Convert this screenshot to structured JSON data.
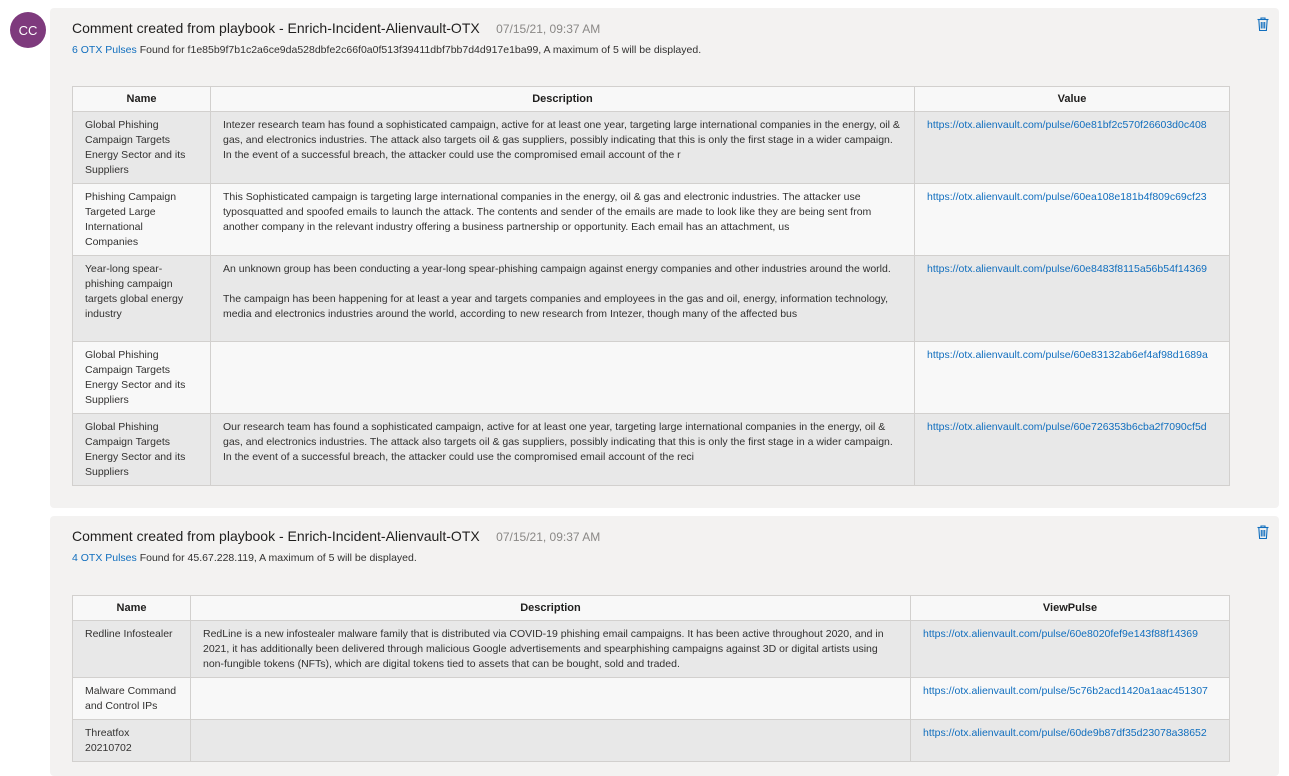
{
  "avatar": {
    "initials": "CC"
  },
  "comments": [
    {
      "title": "Comment created from playbook - Enrich-Incident-Alienvault-OTX",
      "time": "07/15/21, 09:37 AM",
      "link_text": "6 OTX Pulses",
      "summary": " Found for f1e85b9f7b1c2a6ce9da528dbfe2c66f0a0f513f39411dbf7bb7d4d917e1ba99, A maximum of 5 will be displayed.",
      "columns": [
        "Name",
        "Description",
        "Value"
      ],
      "rows": [
        {
          "name": "Global Phishing Campaign Targets Energy Sector and its Suppliers",
          "description": [
            "Intezer research team has found a sophisticated campaign, active for at least one year, targeting large international companies in the energy, oil & gas, and electronics industries. The attack also targets oil & gas suppliers, possibly indicating that this is only the first stage in a wider campaign. In the event of a successful breach, the attacker could use the compromised email account of the r"
          ],
          "value": "https://otx.alienvault.com/pulse/60e81bf2c570f26603d0c408"
        },
        {
          "name": "Phishing Campaign Targeted Large International Companies",
          "description": [
            "This Sophisticated campaign is targeting large international companies in the energy, oil & gas and electronic industries. The attacker use typosquatted and spoofed emails to launch the attack. The contents and sender of the emails are made to look like they are being sent from another company in the relevant industry offering a business partnership or opportunity. Each email has an attachment, us"
          ],
          "value": "https://otx.alienvault.com/pulse/60ea108e181b4f809c69cf23"
        },
        {
          "name": "Year-long spear-phishing campaign targets global energy industry",
          "description": [
            "An unknown group has been conducting a year-long spear-phishing campaign against energy companies and other industries around the world.",
            "The campaign has been happening for at least a year and targets companies and employees in the gas and oil, energy, information technology, media and electronics industries around the world, according to new research from Intezer, though many of the affected bus"
          ],
          "value": "https://otx.alienvault.com/pulse/60e8483f8115a56b54f14369"
        },
        {
          "name": "Global Phishing Campaign Targets Energy Sector and its Suppliers",
          "description": [
            ""
          ],
          "value": "https://otx.alienvault.com/pulse/60e83132ab6ef4af98d1689a"
        },
        {
          "name": "Global Phishing Campaign Targets Energy Sector and its Suppliers",
          "description": [
            "Our research team has found a sophisticated campaign, active for at least one year, targeting large international companies in the energy, oil & gas, and electronics industries. The attack also targets oil & gas suppliers, possibly indicating that this is only the first stage in a wider campaign. In the event of a successful breach, the attacker could use the compromised email account of the reci"
          ],
          "value": "https://otx.alienvault.com/pulse/60e726353b6cba2f7090cf5d"
        }
      ]
    },
    {
      "title": "Comment created from playbook - Enrich-Incident-Alienvault-OTX",
      "time": "07/15/21, 09:37 AM",
      "link_text": "4 OTX Pulses",
      "summary": " Found for 45.67.228.119, A maximum of 5 will be displayed.",
      "columns": [
        "Name",
        "Description",
        "ViewPulse"
      ],
      "rows": [
        {
          "name": "Redline Infostealer",
          "description": [
            "RedLine is a new infostealer malware family that is distributed via COVID-19 phishing email campaigns. It has been active throughout 2020, and in 2021, it has additionally been delivered through malicious Google advertisements and spearphishing campaigns against 3D or digital artists using non-fungible tokens (NFTs), which are digital tokens tied to assets that can be bought, sold and traded."
          ],
          "value": "https://otx.alienvault.com/pulse/60e8020fef9e143f88f14369"
        },
        {
          "name": "Malware Command and Control IPs",
          "description": [
            ""
          ],
          "value": "https://otx.alienvault.com/pulse/5c76b2acd1420a1aac451307"
        },
        {
          "name": "Threatfox 20210702",
          "description": [
            ""
          ],
          "value": "https://otx.alienvault.com/pulse/60de9b87df35d23078a38652"
        }
      ]
    }
  ]
}
